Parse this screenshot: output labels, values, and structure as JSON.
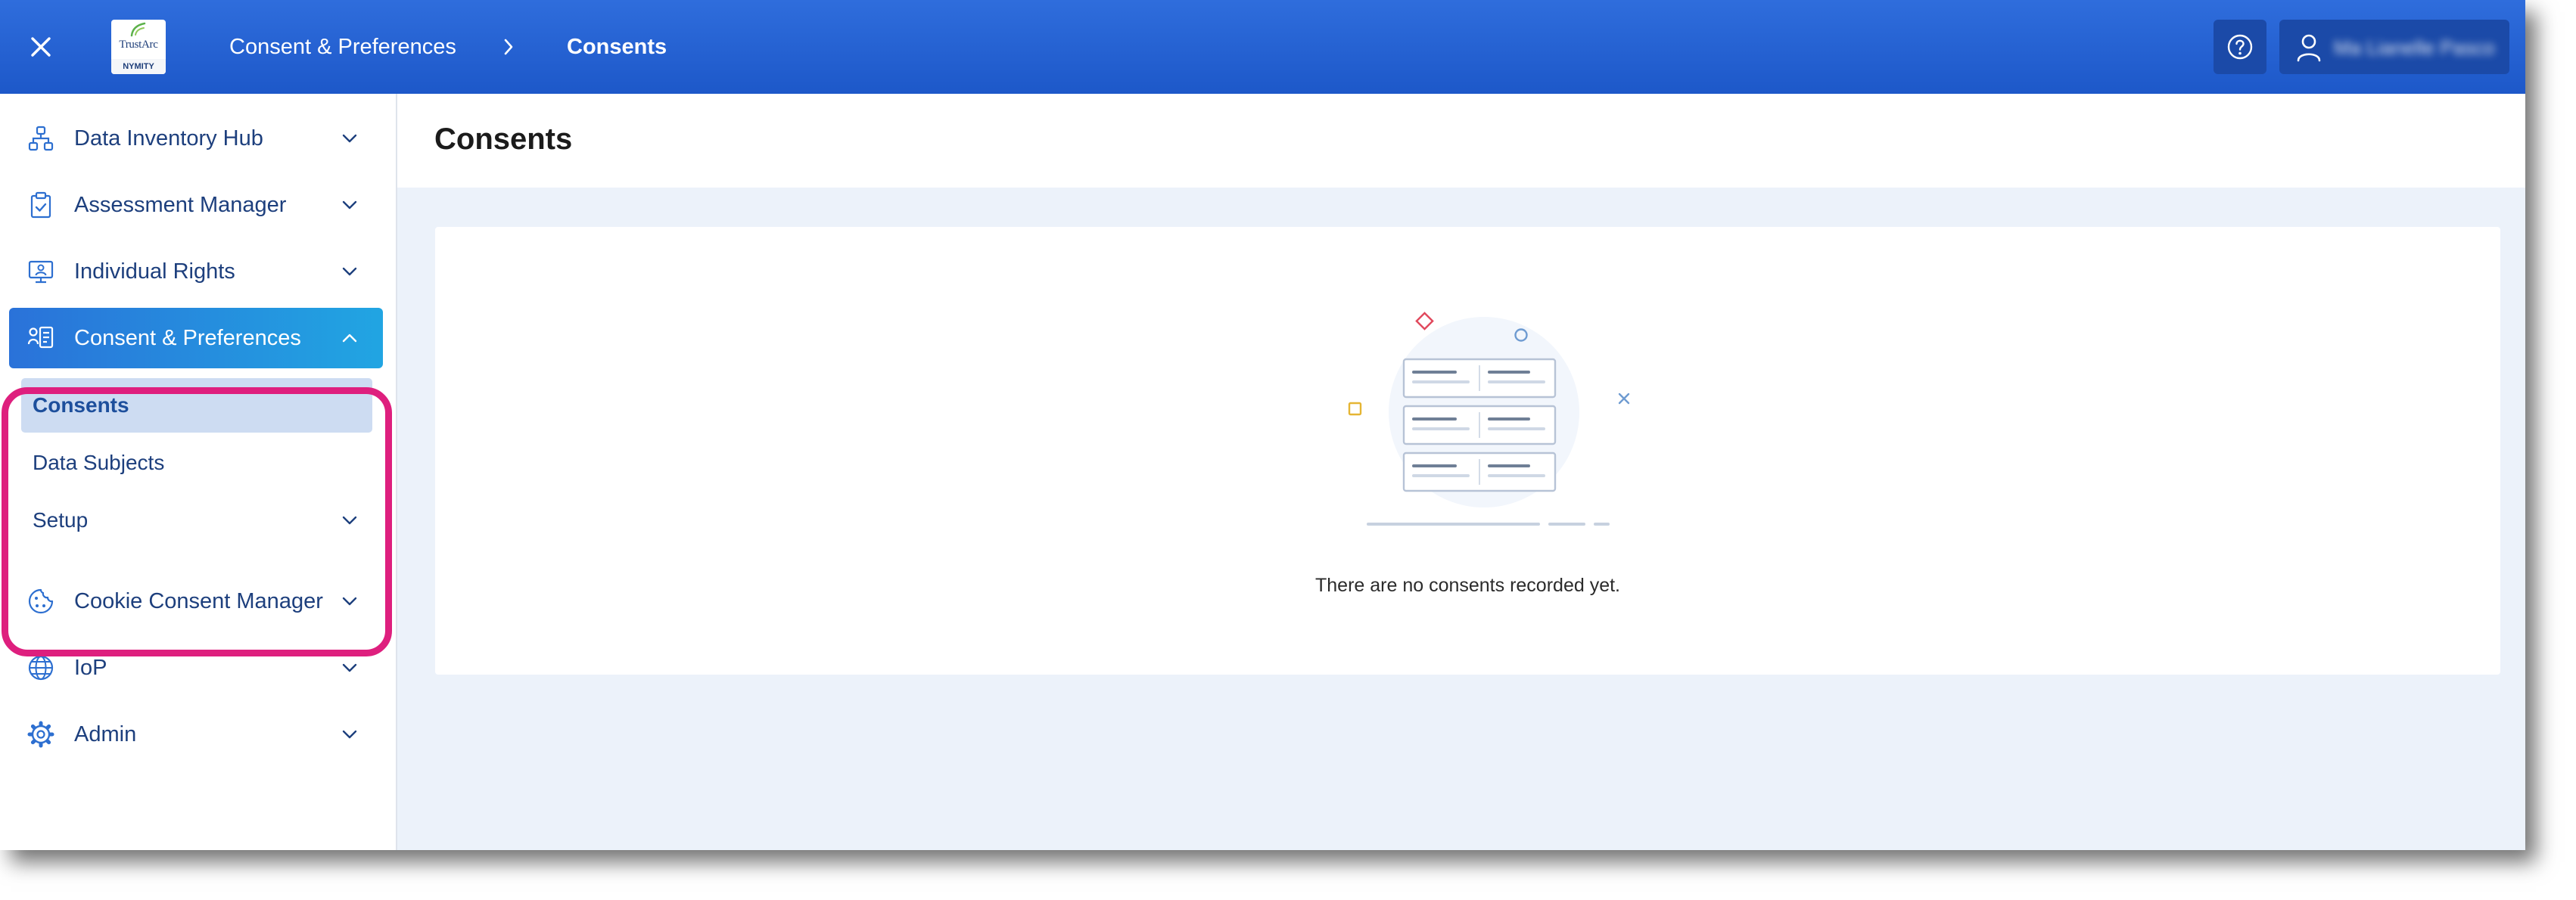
{
  "header": {
    "close_icon": "close-icon",
    "logo": {
      "brand": "TrustArc",
      "sub": "NYMITY"
    },
    "breadcrumb": {
      "parent": "Consent & Preferences",
      "current": "Consents"
    },
    "help_icon": "help-circle-icon",
    "user": {
      "icon": "user-icon",
      "name": "Ma Lianelle Pasco"
    }
  },
  "sidebar": {
    "items": [
      {
        "label": "Data Inventory Hub",
        "icon": "data-inventory-icon",
        "expanded": false
      },
      {
        "label": "Assessment Manager",
        "icon": "clipboard-check-icon",
        "expanded": false
      },
      {
        "label": "Individual Rights",
        "icon": "monitor-user-icon",
        "expanded": false
      },
      {
        "label": "Consent & Preferences",
        "icon": "consent-icon",
        "expanded": true,
        "children": [
          {
            "label": "Consents",
            "selected": true
          },
          {
            "label": "Data Subjects"
          },
          {
            "label": "Setup",
            "expandable": true
          }
        ]
      },
      {
        "label": "Cookie Consent Manager",
        "icon": "cookie-icon",
        "expanded": false
      },
      {
        "label": "IoP",
        "icon": "globe-icon",
        "expanded": false
      },
      {
        "label": "Admin",
        "icon": "gear-icon",
        "expanded": false
      }
    ]
  },
  "main": {
    "title": "Consents",
    "empty_message": "There are no consents recorded yet."
  },
  "colors": {
    "topbar": "#1d58c9",
    "active_nav": "#21a5e2",
    "highlight": "#de1f7e",
    "selected_sub": "#cddcf2",
    "nav_text": "#1d3f7d",
    "main_bg": "#ecf2fa"
  }
}
